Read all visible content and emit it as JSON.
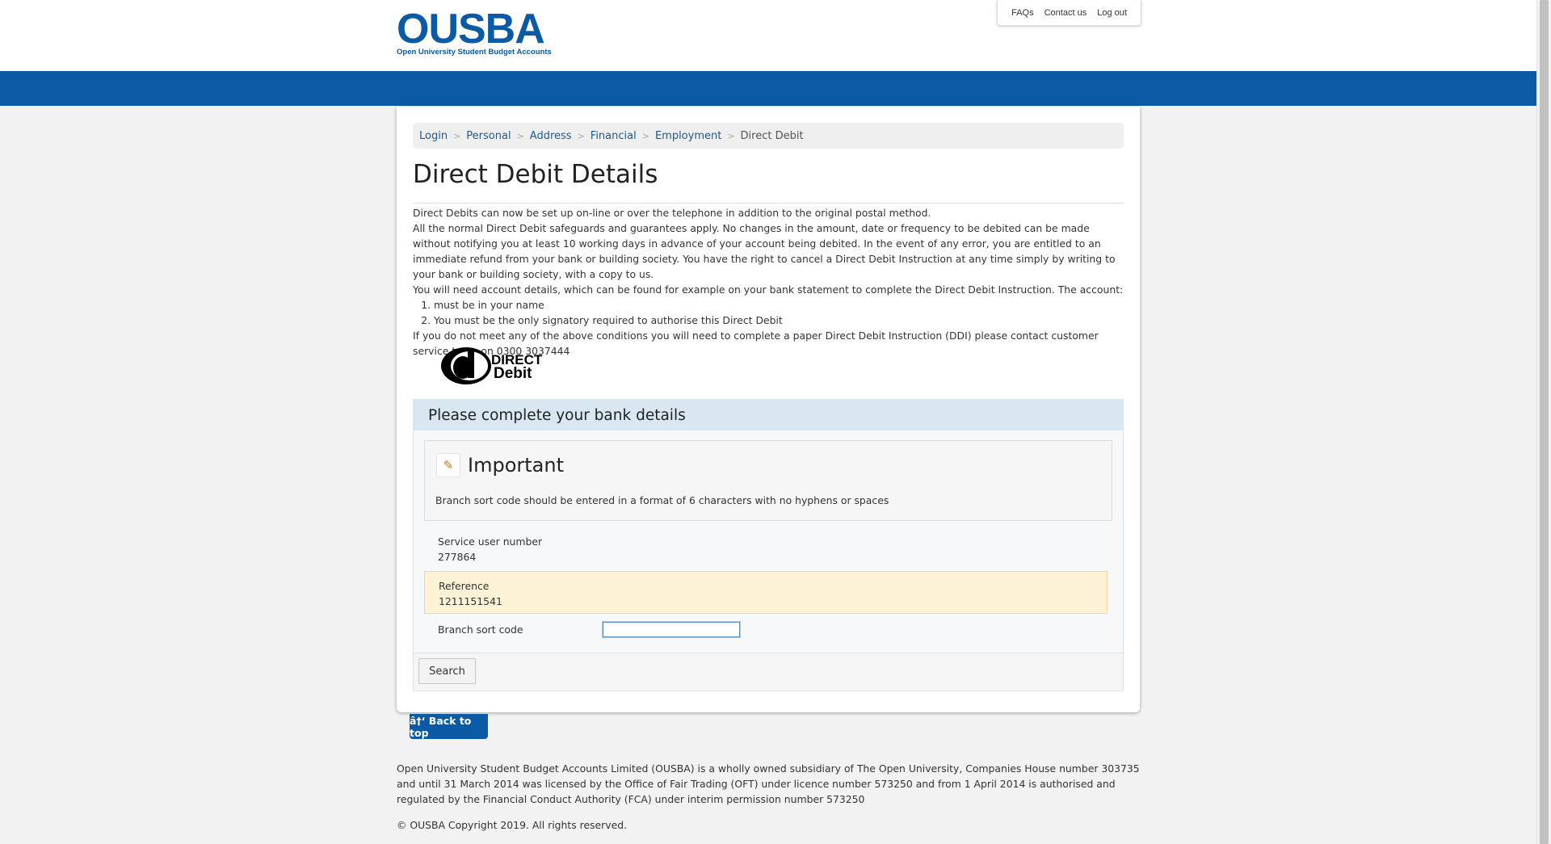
{
  "logo": {
    "mark": "OUSBA",
    "sub": "Open University Student Budget Accounts"
  },
  "toplinks": {
    "faqs": "FAQs",
    "contact": "Contact us",
    "logout": "Log out"
  },
  "breadcrumb": {
    "items": [
      "Login",
      "Personal",
      "Address",
      "Financial",
      "Employment"
    ],
    "current": "Direct Debit"
  },
  "page": {
    "title": "Direct Debit Details"
  },
  "intro": {
    "p1": "Direct Debits can now be set up on-line or over the telephone in addition to the original postal method.",
    "p2": "All the normal Direct Debit safeguards and guarantees apply. No changes in the amount, date or frequency to be debited can be made without notifying you at least 10 working days in advance of your account being debited. In the event of any error, you are entitled to an immediate refund from your bank or building society. You have the right to cancel a Direct Debit Instruction at any time simply by writing to your bank or building society, with a copy to us.",
    "p3": "You will need account details, which can be found for example on your bank statement to complete the Direct Debit Instruction. The account:",
    "list": [
      "must be in your name",
      "You must be the only signatory required to authorise this Direct Debit"
    ],
    "p4": "If you do not meet any of the above conditions you will need to complete a paper Direct Debit Instruction (DDI) please contact customer service team on 0300 3037444"
  },
  "dd_logo": {
    "line1": "DIRECT",
    "line2": "Debit"
  },
  "bank_panel": {
    "heading": "Please complete your bank details",
    "important_title": "Important",
    "important_text": "Branch sort code should be entered in a format of 6 characters with no hyphens or spaces",
    "service_label": "Service user number",
    "service_value": "277864",
    "reference_label": "Reference",
    "reference_value": "1211151541",
    "sort_label": "Branch sort code",
    "sort_value": ""
  },
  "buttons": {
    "search": "Search",
    "back_top": "â†‘ Back to top"
  },
  "footer": {
    "p1": "Open University Student Budget Accounts Limited (OUSBA) is a wholly owned subsidiary of The Open University, Companies House number 303735 and until 31 March 2014 was licensed by the Office of Fair Trading (OFT) under licence number 573250 and from 1 April 2014 is authorised and regulated by the Financial Conduct Authority (FCA) under interim permission number 573250",
    "copyright": "© OUSBA Copyright 2019. All rights reserved."
  },
  "colors": {
    "brand_blue": "#0a5aa5",
    "panel_head": "#d8e7f1",
    "reference_highlight": "#fdf2d5"
  }
}
